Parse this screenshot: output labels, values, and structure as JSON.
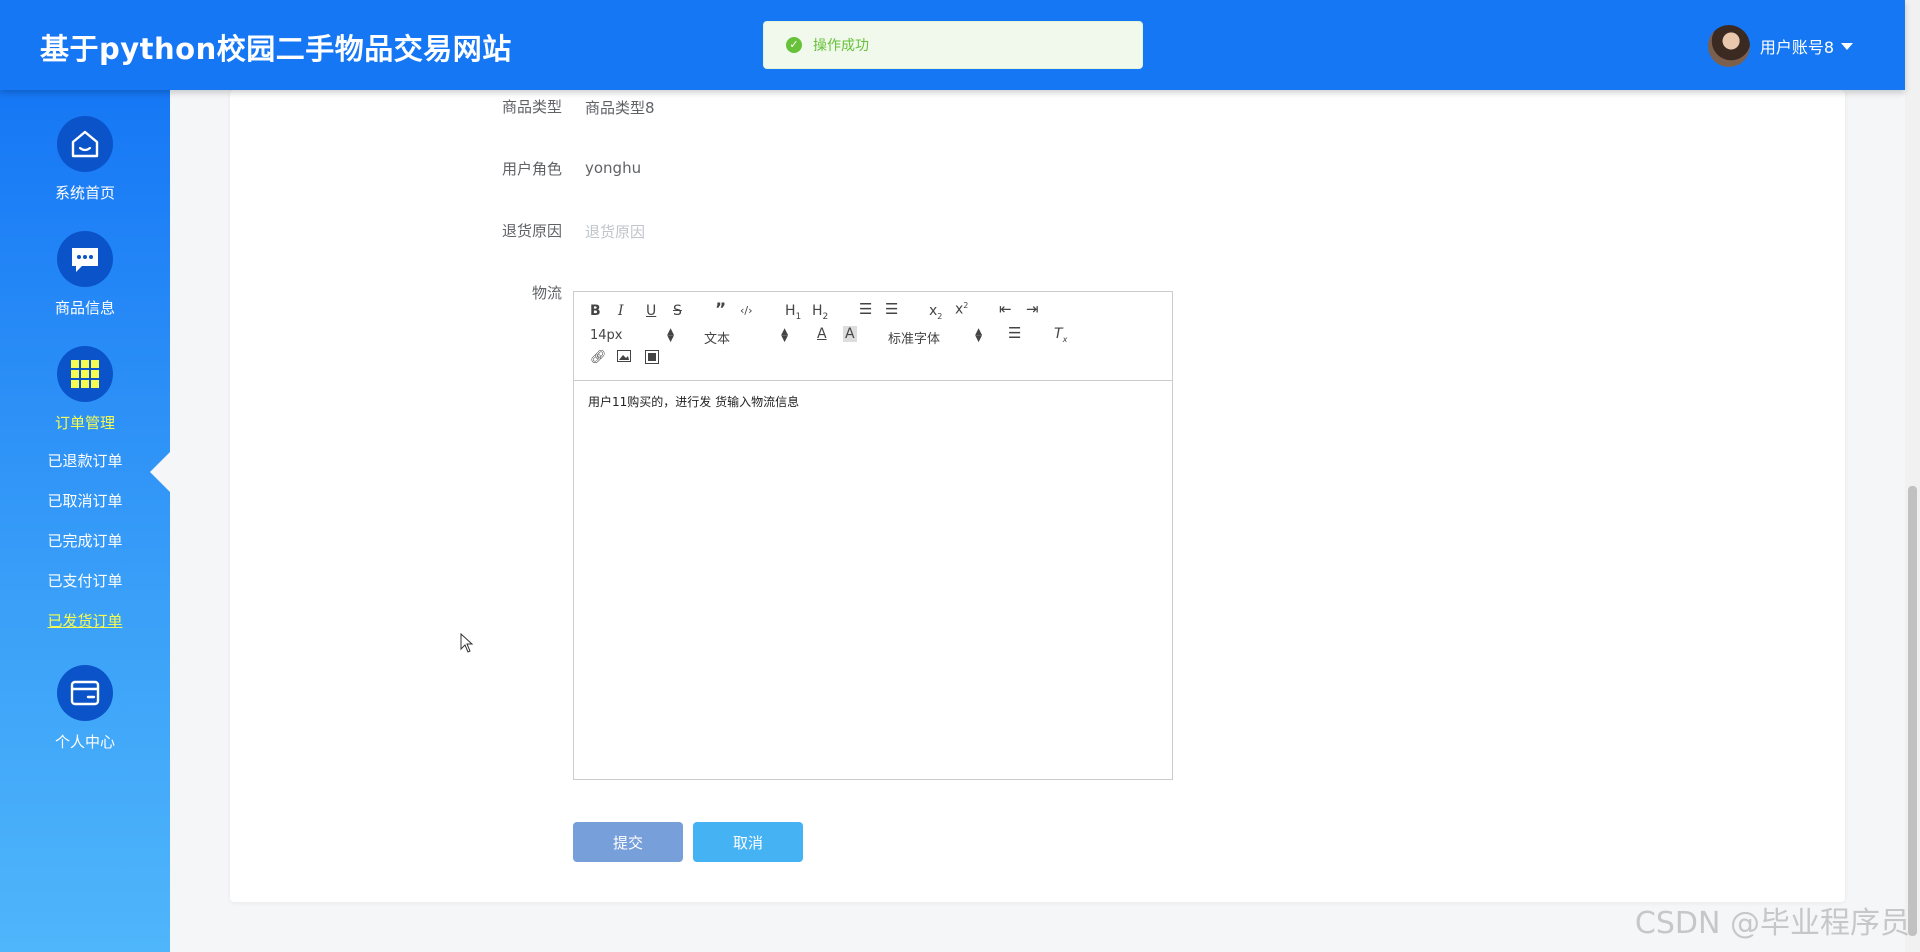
{
  "header": {
    "title": "基于python校园二手物品交易网站",
    "toast": "操作成功",
    "user_name": "用户账号8"
  },
  "sidebar": {
    "items": [
      {
        "label": "系统首页",
        "icon": "home-icon"
      },
      {
        "label": "商品信息",
        "icon": "chat-icon"
      },
      {
        "label": "订单管理",
        "icon": "grid-icon"
      },
      {
        "label": "个人中心",
        "icon": "wallet-icon"
      }
    ],
    "sub_items": [
      "已退款订单",
      "已取消订单",
      "已完成订单",
      "已支付订单",
      "已发货订单"
    ]
  },
  "form": {
    "rows": [
      {
        "label": "商品类型",
        "value": "商品类型8"
      },
      {
        "label": "用户角色",
        "value": "yonghu"
      },
      {
        "label": "退货原因",
        "value": "退货原因"
      }
    ],
    "logistics_label": "物流",
    "editor": {
      "font_size": "14px",
      "block_type": "文本",
      "font_family": "标准字体",
      "content": "用户11购买的，进行发 货输入物流信息"
    },
    "submit_label": "提交",
    "cancel_label": "取消"
  },
  "watermark": "CSDN @毕业程序员",
  "colors": {
    "header": "#1677f5",
    "active_nav": "#f6fb51",
    "success": "#67c23a",
    "submit": "#779fd9",
    "cancel": "#45b2f3"
  }
}
